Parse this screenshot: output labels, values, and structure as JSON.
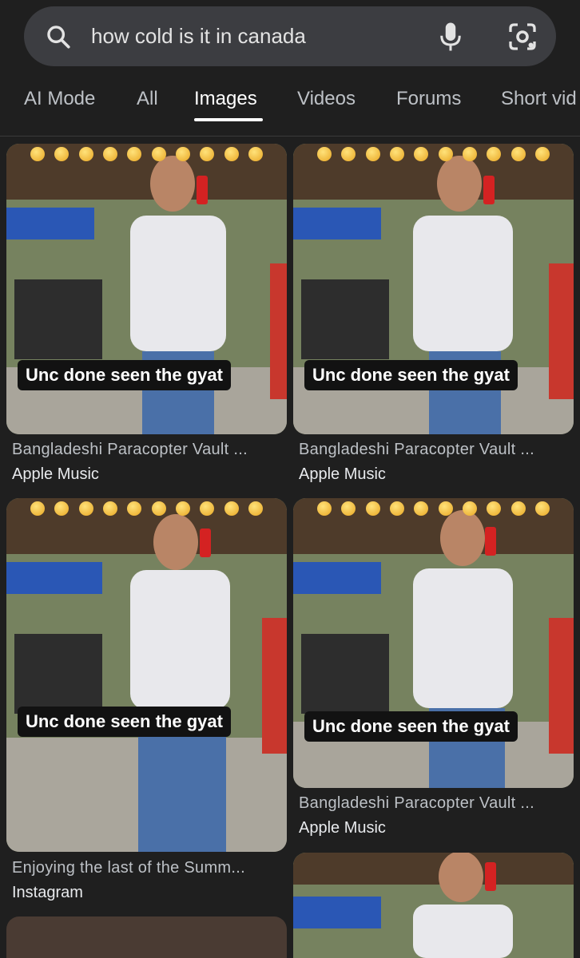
{
  "search": {
    "query": "how cold is it in canada"
  },
  "tabs": [
    {
      "label": "AI Mode"
    },
    {
      "label": "All"
    },
    {
      "label": "Images",
      "active": true
    },
    {
      "label": "Videos"
    },
    {
      "label": "Forums"
    },
    {
      "label": "Short vid"
    }
  ],
  "results": [
    {
      "caption": "Unc done seen the gyat",
      "title": "Bangladeshi Paracopter Vault ...",
      "source": "Apple Music"
    },
    {
      "caption": "Unc done seen the gyat",
      "title": "Bangladeshi Paracopter Vault ...",
      "source": "Apple Music"
    },
    {
      "caption": "Unc done seen the gyat",
      "title": "Enjoying the last of the Summ...",
      "source": "Instagram"
    },
    {
      "caption": "Unc done seen the gyat",
      "title": "Bangladeshi Paracopter Vault ...",
      "source": "Apple Music"
    }
  ],
  "icons": {
    "search": "search-icon",
    "mic": "mic-icon",
    "lens": "camera-lens-icon"
  }
}
